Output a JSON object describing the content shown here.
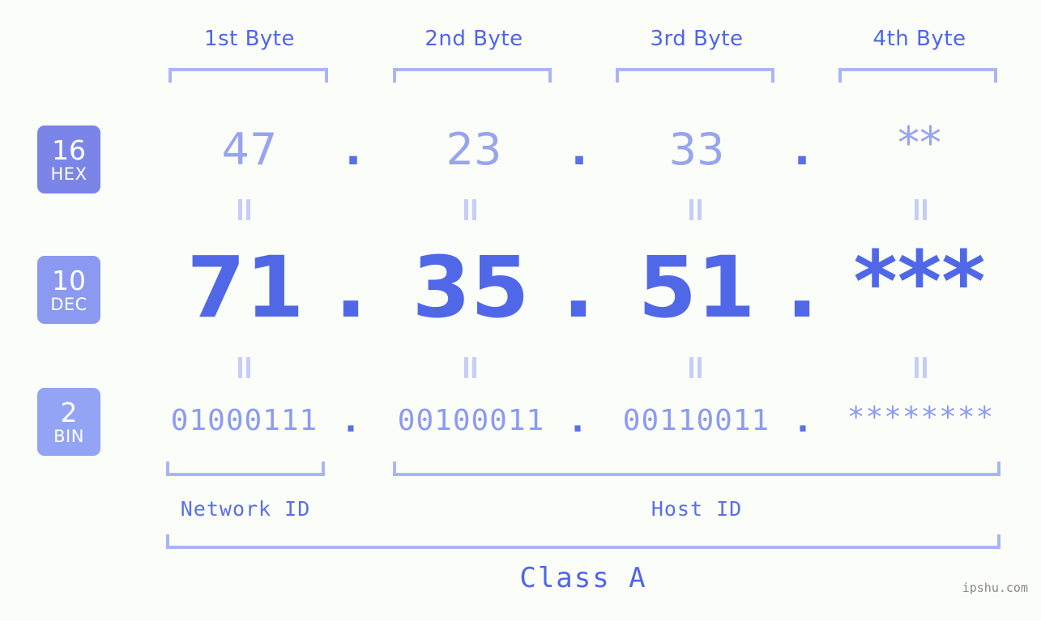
{
  "background_color": "#fbfdf8",
  "accent_color": "#4f66e8",
  "header": {
    "bytes": [
      {
        "label": "1st Byte"
      },
      {
        "label": "2nd Byte"
      },
      {
        "label": "3rd Byte"
      },
      {
        "label": "4th Byte"
      }
    ]
  },
  "rows": {
    "hex": {
      "badge_number": "16",
      "badge_word": "HEX",
      "badge_color": "#7b85e8",
      "value_color": "#97a4f0",
      "values": [
        "47",
        "23",
        "33",
        "**"
      ],
      "separator": "."
    },
    "dec": {
      "badge_number": "10",
      "badge_word": "DEC",
      "badge_color": "#8b99f0",
      "value_color": "#5068e8",
      "values": [
        "71",
        "35",
        "51",
        "***"
      ],
      "separator": "."
    },
    "bin": {
      "badge_number": "2",
      "badge_word": "BIN",
      "badge_color": "#93a4f4",
      "value_color": "#8c9bf2",
      "values": [
        "01000111",
        "00100011",
        "00110011",
        "********"
      ],
      "separator": "."
    }
  },
  "equals_symbol": "=",
  "footer": {
    "network_id_label": "Network ID",
    "host_id_label": "Host ID",
    "class_label": "Class A"
  },
  "watermark": "ipshu.com"
}
